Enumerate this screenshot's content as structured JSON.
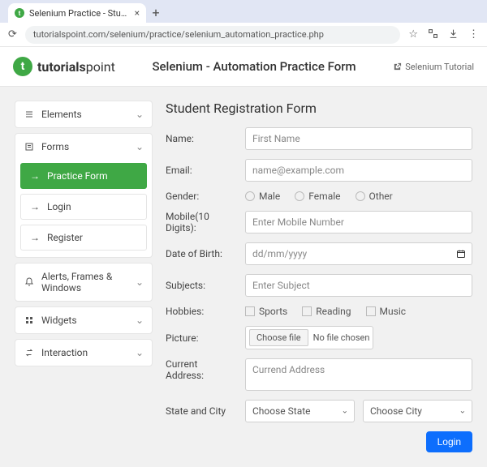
{
  "browser": {
    "tab_title": "Selenium Practice - Student |",
    "url": "tutorialspoint.com/selenium/practice/selenium_automation_practice.php"
  },
  "header": {
    "logo_bold": "tutorials",
    "logo_light": "point",
    "page_title": "Selenium - Automation Practice Form",
    "link_text": "Selenium Tutorial"
  },
  "sidebar": {
    "elements_label": "Elements",
    "forms_label": "Forms",
    "practice_form_label": "Practice Form",
    "login_label": "Login",
    "register_label": "Register",
    "alerts_label": "Alerts, Frames & Windows",
    "widgets_label": "Widgets",
    "interaction_label": "Interaction"
  },
  "form": {
    "title": "Student Registration Form",
    "name_label": "Name:",
    "name_placeholder": "First Name",
    "email_label": "Email:",
    "email_placeholder": "name@example.com",
    "gender_label": "Gender:",
    "gender_male": "Male",
    "gender_female": "Female",
    "gender_other": "Other",
    "mobile_label": "Mobile(10 Digits):",
    "mobile_placeholder": "Enter Mobile Number",
    "dob_label": "Date of Birth:",
    "dob_placeholder": "dd/mm/yyyy",
    "subjects_label": "Subjects:",
    "subjects_placeholder": "Enter Subject",
    "hobbies_label": "Hobbies:",
    "hobby_sports": "Sports",
    "hobby_reading": "Reading",
    "hobby_music": "Music",
    "picture_label": "Picture:",
    "file_btn": "Choose file",
    "file_status": "No file chosen",
    "address_label": "Current Address:",
    "address_placeholder": "Currend Address",
    "state_city_label": "State and City",
    "state_selected": "Choose State",
    "city_selected": "Choose City",
    "login_btn": "Login"
  }
}
